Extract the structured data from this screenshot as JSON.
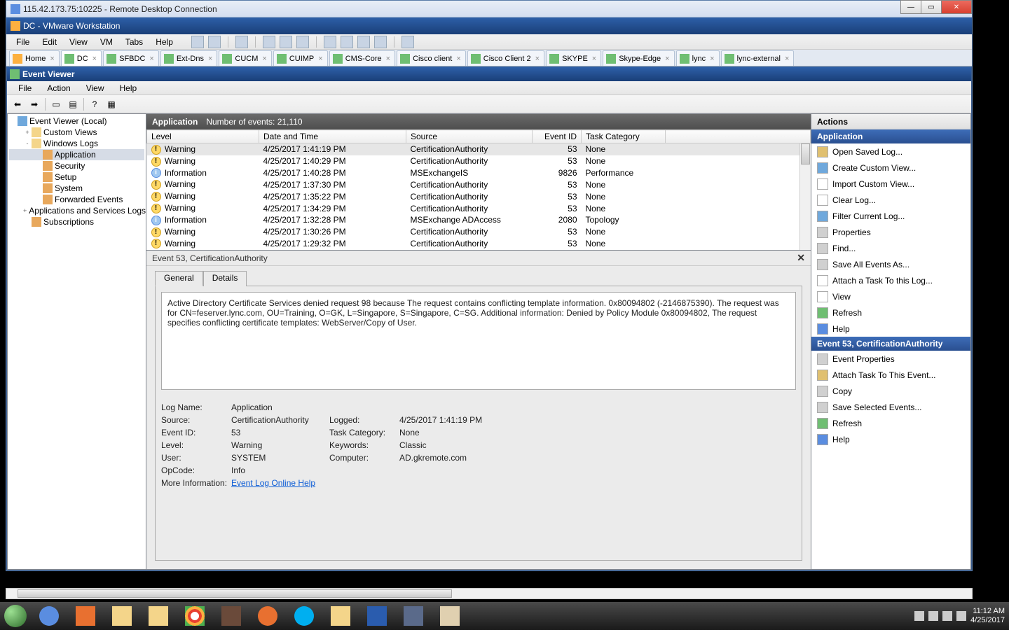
{
  "outer": {
    "title": "115.42.173.75:10225 - Remote Desktop Connection"
  },
  "vmware": {
    "title": "DC - VMware Workstation",
    "menu": [
      "File",
      "Edit",
      "View",
      "VM",
      "Tabs",
      "Help"
    ],
    "tabs": [
      {
        "label": "Home",
        "kind": "home"
      },
      {
        "label": "DC",
        "kind": "vm",
        "active": true
      },
      {
        "label": "SFBDC",
        "kind": "vm"
      },
      {
        "label": "Ext-Dns",
        "kind": "vm"
      },
      {
        "label": "CUCM",
        "kind": "vm"
      },
      {
        "label": "CUIMP",
        "kind": "vm"
      },
      {
        "label": "CMS-Core",
        "kind": "vm"
      },
      {
        "label": "Cisco client",
        "kind": "vm"
      },
      {
        "label": "Cisco Client 2",
        "kind": "vm"
      },
      {
        "label": "SKYPE",
        "kind": "vm"
      },
      {
        "label": "Skype-Edge",
        "kind": "vm"
      },
      {
        "label": "lync",
        "kind": "vm"
      },
      {
        "label": "lync-external",
        "kind": "vm"
      }
    ]
  },
  "eventviewer": {
    "title": "Event Viewer",
    "menu": [
      "File",
      "Action",
      "View",
      "Help"
    ],
    "tree": {
      "root": "Event Viewer (Local)",
      "nodes": [
        {
          "label": "Custom Views",
          "indent": 1,
          "toggle": "+",
          "icon": "folder"
        },
        {
          "label": "Windows Logs",
          "indent": 1,
          "toggle": "-",
          "icon": "folder"
        },
        {
          "label": "Application",
          "indent": 2,
          "icon": "log",
          "sel": true
        },
        {
          "label": "Security",
          "indent": 2,
          "icon": "log"
        },
        {
          "label": "Setup",
          "indent": 2,
          "icon": "log"
        },
        {
          "label": "System",
          "indent": 2,
          "icon": "log"
        },
        {
          "label": "Forwarded Events",
          "indent": 2,
          "icon": "log"
        },
        {
          "label": "Applications and Services Logs",
          "indent": 1,
          "toggle": "+",
          "icon": "folder"
        },
        {
          "label": "Subscriptions",
          "indent": 1,
          "icon": "log"
        }
      ]
    },
    "center": {
      "title": "Application",
      "count_label": "Number of events: 21,110",
      "columns": [
        "Level",
        "Date and Time",
        "Source",
        "Event ID",
        "Task Category"
      ],
      "rows": [
        {
          "icon": "warn",
          "level": "Warning",
          "date": "4/25/2017 1:41:19 PM",
          "src": "CertificationAuthority",
          "id": "53",
          "cat": "None",
          "sel": true
        },
        {
          "icon": "warn",
          "level": "Warning",
          "date": "4/25/2017 1:40:29 PM",
          "src": "CertificationAuthority",
          "id": "53",
          "cat": "None"
        },
        {
          "icon": "info",
          "level": "Information",
          "date": "4/25/2017 1:40:28 PM",
          "src": "MSExchangeIS",
          "id": "9826",
          "cat": "Performance"
        },
        {
          "icon": "warn",
          "level": "Warning",
          "date": "4/25/2017 1:37:30 PM",
          "src": "CertificationAuthority",
          "id": "53",
          "cat": "None"
        },
        {
          "icon": "warn",
          "level": "Warning",
          "date": "4/25/2017 1:35:22 PM",
          "src": "CertificationAuthority",
          "id": "53",
          "cat": "None"
        },
        {
          "icon": "warn",
          "level": "Warning",
          "date": "4/25/2017 1:34:29 PM",
          "src": "CertificationAuthority",
          "id": "53",
          "cat": "None"
        },
        {
          "icon": "info",
          "level": "Information",
          "date": "4/25/2017 1:32:28 PM",
          "src": "MSExchange ADAccess",
          "id": "2080",
          "cat": "Topology"
        },
        {
          "icon": "warn",
          "level": "Warning",
          "date": "4/25/2017 1:30:26 PM",
          "src": "CertificationAuthority",
          "id": "53",
          "cat": "None"
        },
        {
          "icon": "warn",
          "level": "Warning",
          "date": "4/25/2017 1:29:32 PM",
          "src": "CertificationAuthority",
          "id": "53",
          "cat": "None"
        }
      ]
    },
    "detail": {
      "title": "Event 53, CertificationAuthority",
      "tabs": [
        "General",
        "Details"
      ],
      "message": "Active Directory Certificate Services denied request 98 because The request contains conflicting template information. 0x80094802 (-2146875390).  The request was for CN=feserver.lync.com, OU=Training, O=GK, L=Singapore, S=Singapore, C=SG.  Additional information: Denied by Policy Module  0x80094802, The request specifies conflicting certificate templates: WebServer/Copy of User.",
      "fields": {
        "log_name_lbl": "Log Name:",
        "log_name": "Application",
        "source_lbl": "Source:",
        "source": "CertificationAuthority",
        "logged_lbl": "Logged:",
        "logged": "4/25/2017 1:41:19 PM",
        "eventid_lbl": "Event ID:",
        "eventid": "53",
        "taskcat_lbl": "Task Category:",
        "taskcat": "None",
        "level_lbl": "Level:",
        "level": "Warning",
        "keywords_lbl": "Keywords:",
        "keywords": "Classic",
        "user_lbl": "User:",
        "user": "SYSTEM",
        "computer_lbl": "Computer:",
        "computer": "AD.gkremote.com",
        "opcode_lbl": "OpCode:",
        "opcode": "Info",
        "moreinfo_lbl": "More Information:",
        "moreinfo_link": "Event Log Online Help"
      }
    },
    "actions": {
      "header": "Actions",
      "section1": "Application",
      "items1": [
        {
          "label": "Open Saved Log...",
          "icon": "#e0c070"
        },
        {
          "label": "Create Custom View...",
          "icon": "#6fa8dc"
        },
        {
          "label": "Import Custom View...",
          "icon": "#ffffff"
        },
        {
          "label": "Clear Log...",
          "icon": "#ffffff"
        },
        {
          "label": "Filter Current Log...",
          "icon": "#6fa8dc"
        },
        {
          "label": "Properties",
          "icon": "#d0d0d0"
        },
        {
          "label": "Find...",
          "icon": "#d0d0d0"
        },
        {
          "label": "Save All Events As...",
          "icon": "#d0d0d0"
        },
        {
          "label": "Attach a Task To this Log...",
          "icon": "#ffffff"
        },
        {
          "label": "View",
          "icon": "#ffffff"
        },
        {
          "label": "Refresh",
          "icon": "#6fbe72"
        },
        {
          "label": "Help",
          "icon": "#5a8de0"
        }
      ],
      "section2": "Event 53, CertificationAuthority",
      "items2": [
        {
          "label": "Event Properties",
          "icon": "#d0d0d0"
        },
        {
          "label": "Attach Task To This Event...",
          "icon": "#e0c070"
        },
        {
          "label": "Copy",
          "icon": "#d0d0d0"
        },
        {
          "label": "Save Selected Events...",
          "icon": "#d0d0d0"
        },
        {
          "label": "Refresh",
          "icon": "#6fbe72"
        },
        {
          "label": "Help",
          "icon": "#5a8de0"
        }
      ]
    }
  },
  "tray": {
    "time": "11:12 AM",
    "date": "4/25/2017"
  }
}
